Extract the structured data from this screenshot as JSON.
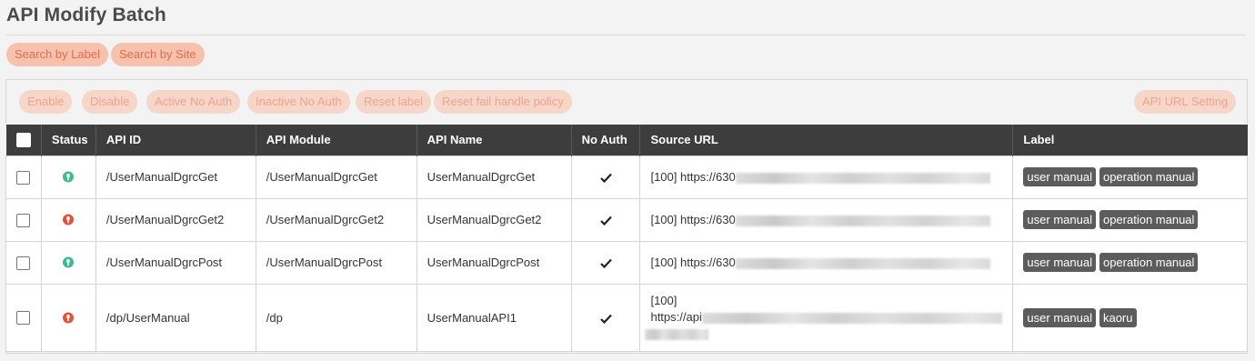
{
  "page": {
    "title": "API Modify Batch"
  },
  "search_buttons": [
    "Search by Label",
    "Search by Site"
  ],
  "toolbar": {
    "enable": "Enable",
    "disable": "Disable",
    "active_no_auth": "Active No Auth",
    "inactive_no_auth": "Inactive No Auth",
    "reset_label": "Reset label",
    "reset_fail": "Reset fail handle policy",
    "api_url_setting": "API URL Setting"
  },
  "table": {
    "headers": [
      "Status",
      "API ID",
      "API Module",
      "API Name",
      "No Auth",
      "Source URL",
      "Label"
    ],
    "rows": [
      {
        "status": "active",
        "api_id": "/UserManualDgrcGet",
        "module": "/UserManualDgrcGet",
        "name": "UserManualDgrcGet",
        "no_auth": true,
        "url_prefix": "[100] https://630",
        "url_host": "",
        "labels": [
          "user manual",
          "operation manual"
        ]
      },
      {
        "status": "inactive",
        "api_id": "/UserManualDgrcGet2",
        "module": "/UserManualDgrcGet2",
        "name": "UserManualDgrcGet2",
        "no_auth": true,
        "url_prefix": "[100] https://630",
        "url_host": "",
        "labels": [
          "user manual",
          "operation manual"
        ]
      },
      {
        "status": "active",
        "api_id": "/UserManualDgrcPost",
        "module": "/UserManualDgrcPost",
        "name": "UserManualDgrcPost",
        "no_auth": true,
        "url_prefix": "[100] https://630",
        "url_host": "",
        "labels": [
          "user manual",
          "operation manual"
        ]
      },
      {
        "status": "inactive",
        "api_id": "/dp/UserManual",
        "module": "/dp",
        "name": "UserManualAPI1",
        "no_auth": true,
        "url_prefix": "[100]",
        "url_host": "https://api",
        "labels": [
          "user manual",
          "kaoru"
        ]
      }
    ]
  },
  "colors": {
    "active": "#3dbb8e",
    "inactive": "#e0523c",
    "header_bg": "#3d3d3d"
  }
}
